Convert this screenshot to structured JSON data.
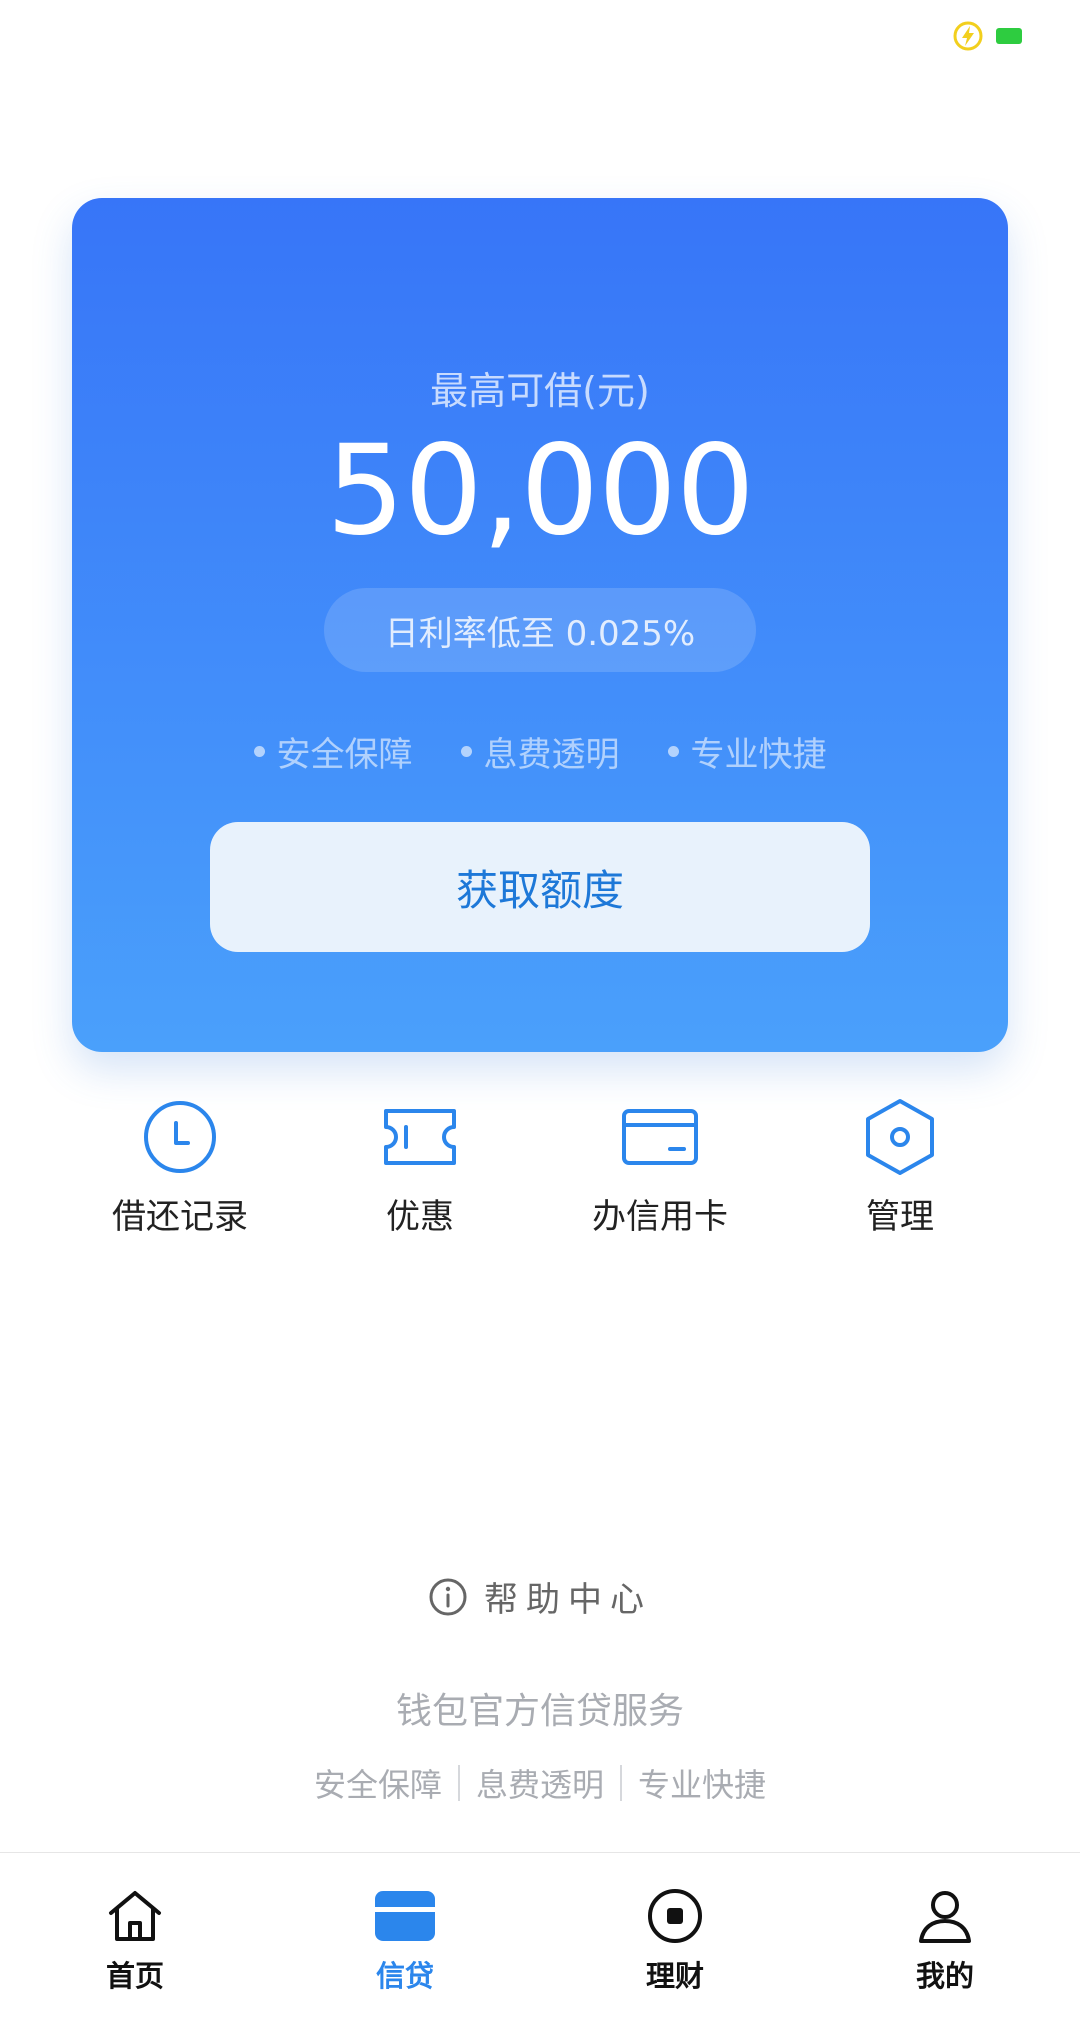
{
  "colors": {
    "brand_blue": "#2b86ec",
    "card_gradient_top": "#3775f8",
    "card_gradient_bottom": "#4aa0fb",
    "button_bg": "#e8f2fc",
    "muted_text": "#a9acb2"
  },
  "status_bar": {
    "icons": [
      "charging-icon",
      "battery-icon"
    ]
  },
  "credit_card": {
    "limit_label": "最高可借(元)",
    "limit_amount": "50,000",
    "rate_text": "日利率低至 0.025%",
    "features": [
      "安全保障",
      "息费透明",
      "专业快捷"
    ],
    "cta_label": "获取额度"
  },
  "quick_actions": [
    {
      "label": "借还记录",
      "icon": "clock-icon"
    },
    {
      "label": "优惠",
      "icon": "coupon-icon"
    },
    {
      "label": "办信用卡",
      "icon": "credit-card-icon"
    },
    {
      "label": "管理",
      "icon": "settings-hexagon-icon"
    }
  ],
  "help": {
    "label": "帮助中心",
    "icon": "info-icon"
  },
  "footer": {
    "title": "钱包官方信贷服务",
    "tags": [
      "安全保障",
      "息费透明",
      "专业快捷"
    ]
  },
  "bottom_nav": {
    "active": "信贷",
    "tabs": [
      {
        "label": "首页",
        "icon": "home-icon"
      },
      {
        "label": "信贷",
        "icon": "card-icon"
      },
      {
        "label": "理财",
        "icon": "wealth-icon"
      },
      {
        "label": "我的",
        "icon": "user-icon"
      }
    ]
  }
}
